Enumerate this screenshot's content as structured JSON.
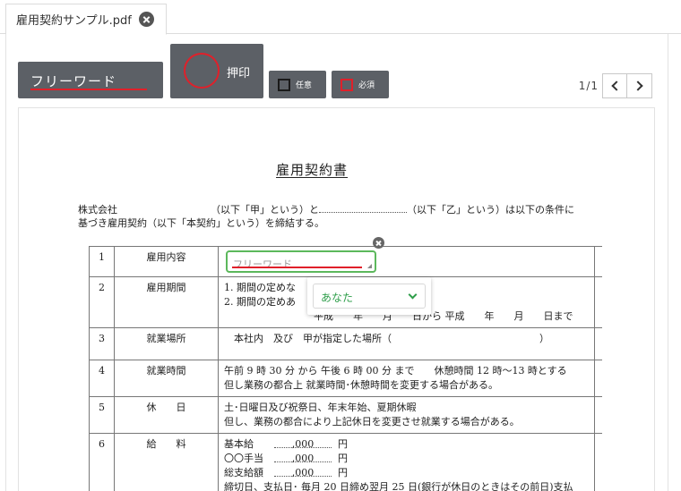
{
  "tab": {
    "title": "雇用契約サンプル.pdf"
  },
  "toolbar": {
    "free_word_label": "フリーワード",
    "stamp_label": "押印",
    "optional_label": "任意",
    "required_label": "必須",
    "accent_red": "#e0202a",
    "button_bg": "#5c6066"
  },
  "pager": {
    "page_indicator": "1/1"
  },
  "document": {
    "title": "雇用契約書",
    "intro_line1_company": "株式会社",
    "intro_line1_mid": "（以下「甲」という）と",
    "intro_line1_end": "（以下「乙」という）は以下の条件に",
    "intro_line2": "基づき雇用契約（以下「本契約」という）を締結する。",
    "rows": [
      {
        "no": "1",
        "item": "雇用内容",
        "content": ""
      },
      {
        "no": "2",
        "item": "雇用期間",
        "content_l1": "1.  期間の定めな",
        "content_l2": "2.  期間の定めあ",
        "content_l3": "平成　　年　　月　　日から  平成　　年　　月　　日まで"
      },
      {
        "no": "3",
        "item": "就業場所",
        "content": "　本社内　及び　甲が指定した場所（　　　　　　　　　　　　　　　）"
      },
      {
        "no": "4",
        "item": "就業時間",
        "content_l1": "午前 9 時 30 分  から  午後 6 時 00 分  まで　　休憩時間  12 時〜13 時とする",
        "content_l2": "但し業務の都合上  就業時間･休憩時間を変更する場合がある。"
      },
      {
        "no": "5",
        "item": "休　　日",
        "content_l1": "土･日曜日及び祝祭日、年末年始、夏期休暇",
        "content_l2": "但し、業務の都合により上記休日を変更させ就業する場合がある。"
      },
      {
        "no": "6",
        "item": "給　　料",
        "pay": [
          {
            "label": "基本給",
            "amount": ",000",
            "unit": "円"
          },
          {
            "label": "〇〇手当",
            "amount": ",000",
            "unit": "円"
          },
          {
            "label": "総支給額",
            "amount": ",000",
            "unit": "円"
          }
        ],
        "content_last": "締切日、支払日･  毎月 20 日締め翌月 25 日(銀行が休日のときはその前日)支払"
      }
    ]
  },
  "overlay": {
    "free_field_placeholder": "フリーワード",
    "assignee_value": "あなた",
    "field_border_color": "#5cb85c",
    "assignee_color": "#2e9e4a"
  }
}
